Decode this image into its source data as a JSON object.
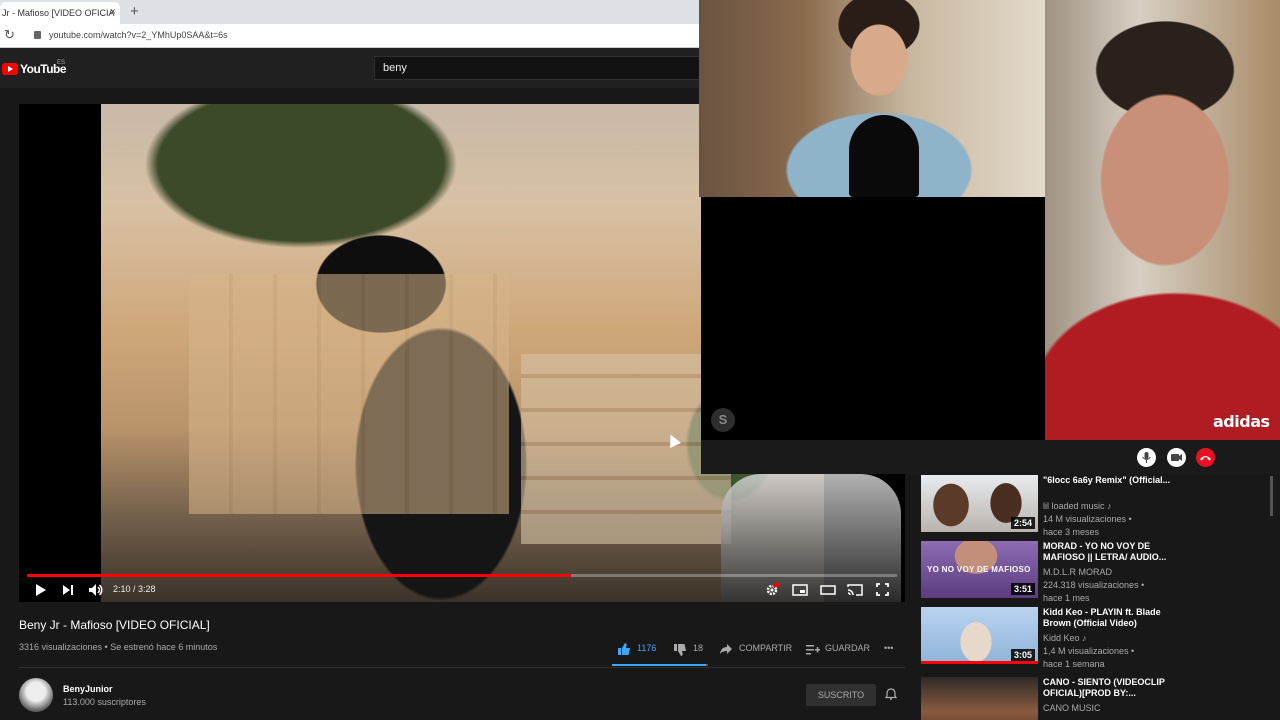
{
  "browser": {
    "tab_title": "Jr - Mafioso [VIDEO OFICIA",
    "tab_close": "×",
    "new_tab": "+",
    "reload": "↻",
    "url": "youtube.com/watch?v=2_YMhUp0SAA&t=6s"
  },
  "youtube": {
    "logo_text": "YouTube",
    "region": "ES",
    "search_value": "beny"
  },
  "player": {
    "time": "2:10 / 3:28",
    "progress_fraction": 0.625
  },
  "video": {
    "title": "Beny Jr - Mafioso [VIDEO OFICIAL]",
    "meta": "3316 visualizaciones • Se estrenó hace 6 minutos",
    "likes": "1176",
    "dislikes": "18",
    "share_label": "COMPARTIR",
    "save_label": "GUARDAR",
    "more": "•••"
  },
  "channel": {
    "name": "BenyJunior",
    "subscribers": "113.000 suscriptores",
    "subscribe_label": "SUSCRITO"
  },
  "call": {
    "badge": "S",
    "shirt_brand": "adidas"
  },
  "recommendations": [
    {
      "title": "\"6locc 6a6y Remix\" (Official...",
      "channel": "lil loaded music ♪",
      "views": "14 M visualizaciones •",
      "ago": "hace 3 meses",
      "duration": "2:54",
      "thumb_color": "#c8c2bb"
    },
    {
      "title": "MORAD - YO NO VOY DE MAFIOSO || LETRA/ AUDIO...",
      "channel": "M.D.L.R MORAD",
      "views": "224.318 visualizaciones •",
      "ago": "hace 1 mes",
      "duration": "3:51",
      "thumb_color": "#7c5aa3",
      "overlay_text": "YO NO VOY DE MAFIOSO"
    },
    {
      "title": "Kidd Keo - PLAYIN ft. Blade Brown (Official Video)",
      "channel": "Kidd Keo ♪",
      "views": "1,4 M visualizaciones •",
      "ago": "hace 1 semana",
      "duration": "3:05",
      "thumb_color": "#9fc0e0"
    },
    {
      "title": "CANO - SIENTO (VIDEOCLIP OFICIAL)[PROD BY:...",
      "channel": "CANO MUSIC",
      "views": "",
      "ago": "",
      "duration": "",
      "thumb_color": "#6b4a3a"
    }
  ]
}
